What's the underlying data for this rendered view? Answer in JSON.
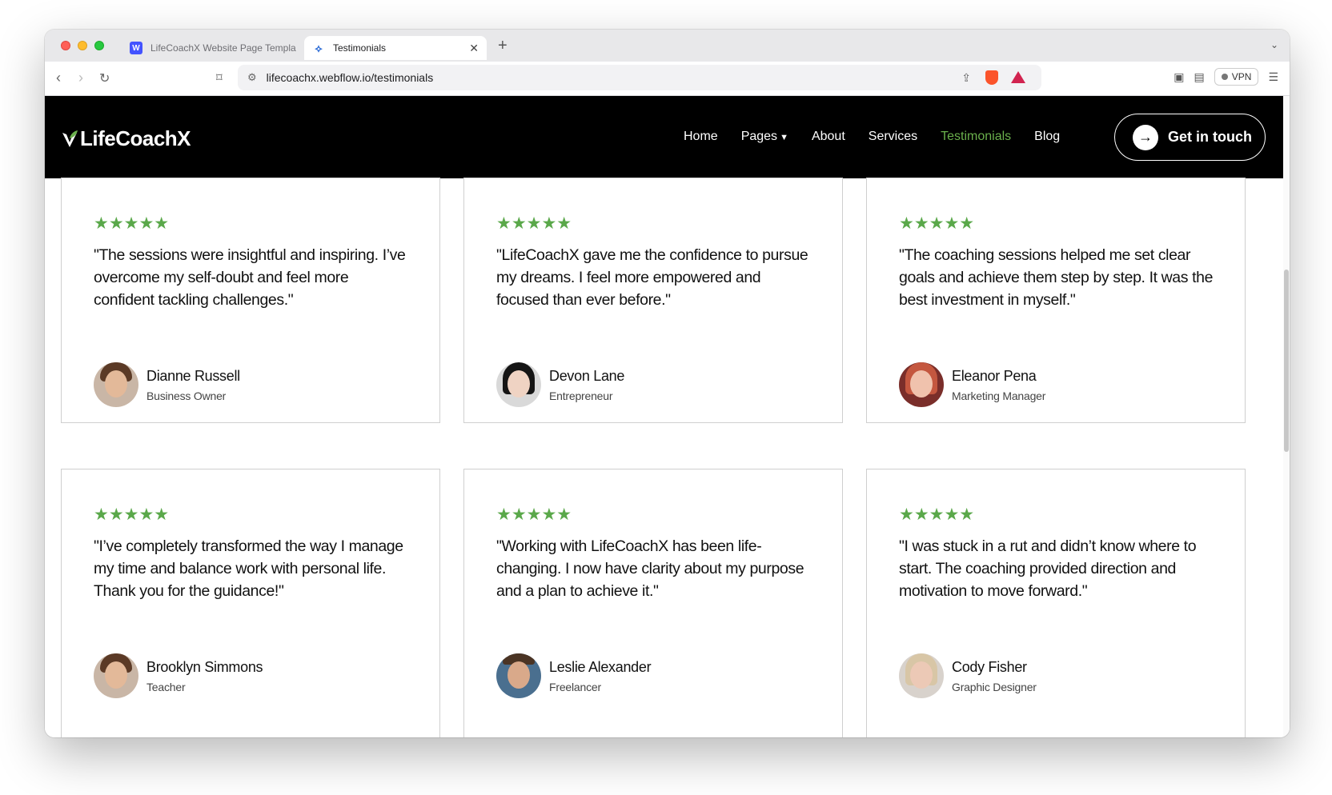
{
  "browser": {
    "tabs": [
      {
        "label": "LifeCoachX Website Page Templa",
        "active": false,
        "icon": "webflow-icon"
      },
      {
        "label": "Testimonials",
        "active": true,
        "icon": "lifecoachx-icon"
      }
    ],
    "url": "lifecoachx.webflow.io/testimonials",
    "vpn_label": "VPN"
  },
  "site": {
    "logo": "LifeCoachX",
    "nav": {
      "home": "Home",
      "pages": "Pages",
      "about": "About",
      "services": "Services",
      "testimonials": "Testimonials",
      "blog": "Blog"
    },
    "cta": "Get in touch",
    "accent_color": "#6ab04c"
  },
  "testimonials": [
    {
      "stars": "★★★★★",
      "quote": "\"The sessions were insightful and inspiring. I’ve overcome my self-doubt and feel more confident tackling challenges.\"",
      "name": "Dianne Russell",
      "role": "Business Owner"
    },
    {
      "stars": "★★★★★",
      "quote": "\"LifeCoachX gave me the confidence to pursue my dreams. I feel more empowered and focused than ever before.\"",
      "name": "Devon Lane",
      "role": "Entrepreneur"
    },
    {
      "stars": "★★★★★",
      "quote": "\"The coaching sessions helped me set clear goals and achieve them step by step. It was the best investment in myself.\"",
      "name": "Eleanor Pena",
      "role": "Marketing Manager"
    },
    {
      "stars": "★★★★★",
      "quote": "\"I’ve completely transformed the way I manage my time and balance work with personal life. Thank you for the guidance!\"",
      "name": "Brooklyn Simmons",
      "role": "Teacher"
    },
    {
      "stars": "★★★★★",
      "quote": "\"Working with LifeCoachX has been life-changing. I now have clarity about my purpose and a plan to achieve it.\"",
      "name": "Leslie Alexander",
      "role": "Freelancer"
    },
    {
      "stars": "★★★★★",
      "quote": "\"I was stuck in a rut and didn’t know where to start. The coaching provided direction and motivation to move forward.\"",
      "name": "Cody Fisher",
      "role": "Graphic Designer"
    }
  ]
}
